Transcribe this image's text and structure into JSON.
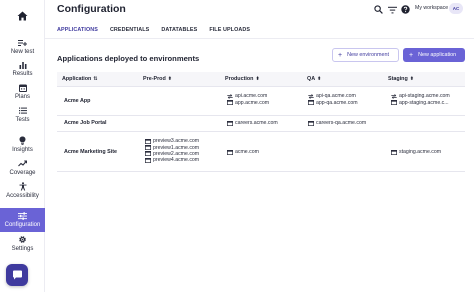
{
  "sidebar": {
    "items": [
      {
        "label": "New test",
        "icon": "list-plus-icon"
      },
      {
        "label": "Results",
        "icon": "bar-chart-icon"
      },
      {
        "label": "Plans",
        "icon": "calendar-icon"
      },
      {
        "label": "Tests",
        "icon": "list-icon"
      },
      {
        "label": "Insights",
        "icon": "bulb-icon"
      },
      {
        "label": "Coverage",
        "icon": "trend-icon"
      },
      {
        "label": "Accessibility",
        "icon": "accessibility-icon"
      },
      {
        "label": "Configuration",
        "icon": "sliders-icon"
      },
      {
        "label": "Settings",
        "icon": "gear-icon"
      }
    ]
  },
  "header": {
    "title": "Configuration",
    "workspace_label": "My workspace",
    "workspace_initials": "AC"
  },
  "tabs": [
    {
      "label": "APPLICATIONS"
    },
    {
      "label": "CREDENTIALS"
    },
    {
      "label": "DATATABLES"
    },
    {
      "label": "FILE UPLOADS"
    }
  ],
  "section": {
    "title": "Applications deployed to environments",
    "new_environment_label": "New environment",
    "new_application_label": "New application"
  },
  "table": {
    "columns": [
      {
        "label": "Application",
        "sort": "⇅"
      },
      {
        "label": "Pre-Prod",
        "sort": "⬍"
      },
      {
        "label": "Production",
        "sort": "⬍"
      },
      {
        "label": "QA",
        "sort": "⬍"
      },
      {
        "label": "Staging",
        "sort": "⬍"
      }
    ],
    "rows": [
      {
        "name": "Acme App",
        "preprod": [],
        "production": [
          {
            "icon": "api-icon",
            "text": "api.acme.com"
          },
          {
            "icon": "browser-icon",
            "text": "app.acme.com"
          }
        ],
        "qa": [
          {
            "icon": "api-icon",
            "text": "api-qa.acme.com"
          },
          {
            "icon": "browser-icon",
            "text": "app-qa.acme.com"
          }
        ],
        "staging": [
          {
            "icon": "api-icon",
            "text": "api-staging.acme.com"
          },
          {
            "icon": "browser-icon",
            "text": "app-staging.acme.c..."
          }
        ]
      },
      {
        "name": "Acme Job Portal",
        "preprod": [],
        "production": [
          {
            "icon": "browser-icon",
            "text": "careers.acme.com"
          }
        ],
        "qa": [
          {
            "icon": "browser-icon",
            "text": "careers-qa.acme.com"
          }
        ],
        "staging": []
      },
      {
        "name": "Acme Marketing Site",
        "preprod": [
          {
            "icon": "browser-icon",
            "text": "preview3.acme.com"
          },
          {
            "icon": "browser-icon",
            "text": "preview1.acme.com"
          },
          {
            "icon": "browser-icon",
            "text": "preview2.acme.com"
          },
          {
            "icon": "browser-icon",
            "text": "preview4.acme.com"
          }
        ],
        "production": [
          {
            "icon": "browser-icon",
            "text": "acme.com"
          }
        ],
        "qa": [],
        "staging": [
          {
            "icon": "browser-icon",
            "text": "staging.acme.com"
          }
        ]
      }
    ]
  },
  "colors": {
    "accent": "#6a63d6",
    "accent_dark": "#3f3a9e",
    "text": "#1f2230",
    "header_bg": "#f6f6f9"
  }
}
